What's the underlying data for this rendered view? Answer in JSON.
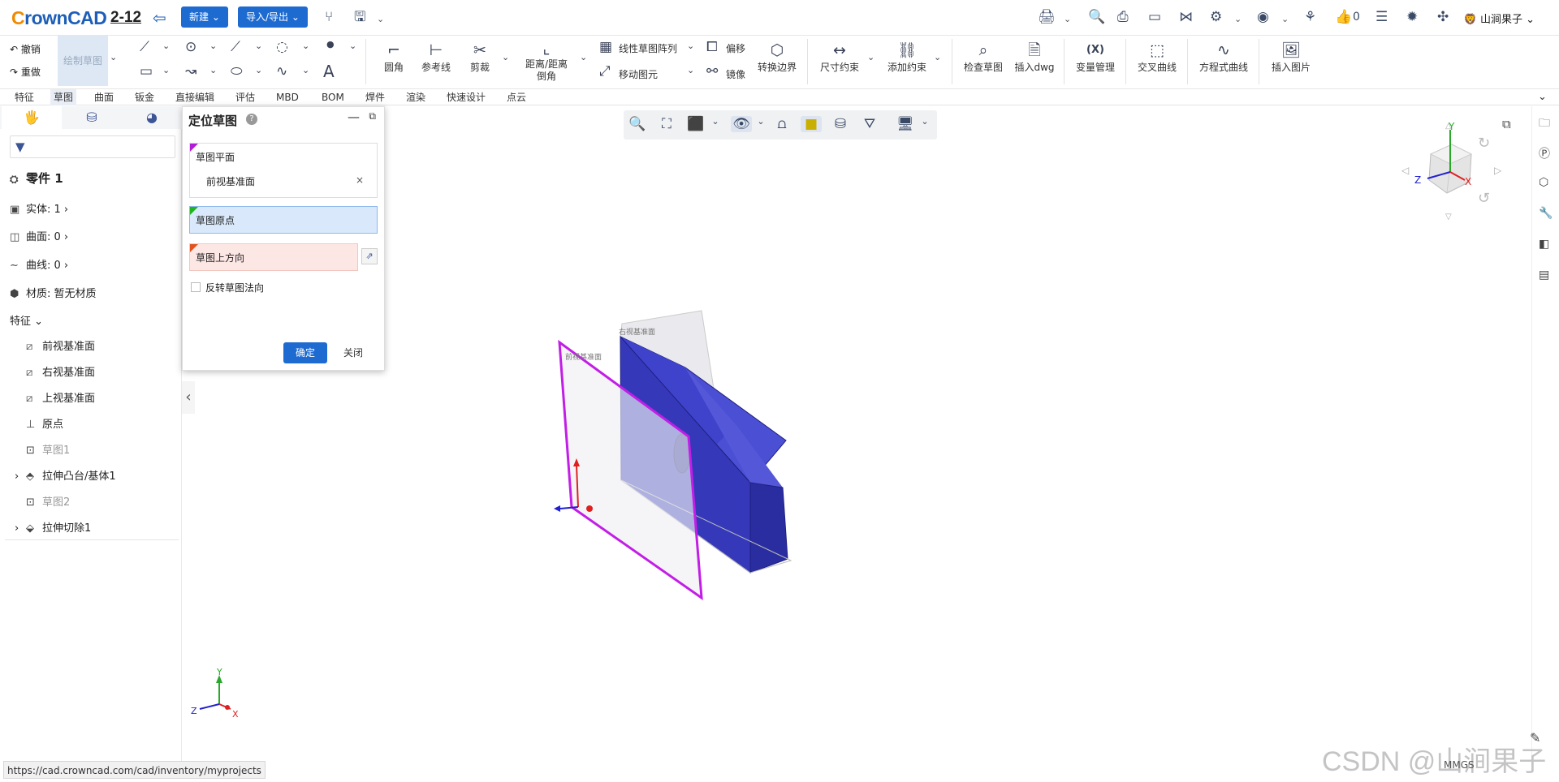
{
  "header": {
    "logo_prefix": "C",
    "logo_rest": "rownCAD",
    "doc_title": "2-12",
    "new_btn": "新建",
    "io_btn": "导入/导出",
    "likes": "0",
    "user": "山涧果子"
  },
  "ribbon": {
    "undo": "撤销",
    "redo": "重做",
    "sketch": "绘制草图",
    "fillet": "圆角",
    "refline": "参考线",
    "trim": "剪裁",
    "distance": "距离/距离",
    "chamfer": "倒角",
    "linear_pattern": "线性草图阵列",
    "move_entity": "移动图元",
    "offset": "偏移",
    "mirror": "镜像",
    "convert": "转换边界",
    "dim": "尺寸约束",
    "add_constraint": "添加约束",
    "check_sketch": "检查草图",
    "insert_dwg": "插入dwg",
    "var_mgr": "变量管理",
    "var_icon": "(X)",
    "intersect": "交叉曲线",
    "equation": "方程式曲线",
    "insert_image": "插入图片"
  },
  "menu_tabs": [
    "特征",
    "草图",
    "曲面",
    "钣金",
    "直接编辑",
    "评估",
    "MBD",
    "BOM",
    "焊件",
    "渲染",
    "快速设计",
    "点云"
  ],
  "tree": {
    "part": "零件 1",
    "solid": "实体: 1",
    "surface": "曲面: 0",
    "curve": "曲线: 0",
    "material": "材质: 暂无材质",
    "features_header": "特征",
    "items": [
      "前视基准面",
      "右视基准面",
      "上视基准面",
      "原点",
      "草图1",
      "拉伸凸台/基体1",
      "草图2",
      "拉伸切除1"
    ]
  },
  "dialog": {
    "title": "定位草图",
    "help": "?",
    "plane_label": "草图平面",
    "plane_value": "前视基准面",
    "plane_remove": "×",
    "origin_label": "草图原点",
    "up_label": "草图上方向",
    "flip_label": "反转草图法向",
    "ok": "确定",
    "close": "关闭",
    "colors": {
      "plane": "#b01ed6",
      "origin": "#1fb51f",
      "up": "#e0531e"
    }
  },
  "viewport": {
    "triad_x": "X",
    "triad_y": "Y",
    "triad_z": "Z",
    "plane_text": "前视基准面",
    "plane_text2": "右视基准面",
    "colors": {
      "body": "#3b3ec9",
      "plane": "#c21ee6"
    }
  },
  "status": {
    "url": "https://cad.crowncad.com/cad/inventory/myprojects",
    "watermark": "CSDN @山涧果子",
    "units": "MMGS"
  }
}
